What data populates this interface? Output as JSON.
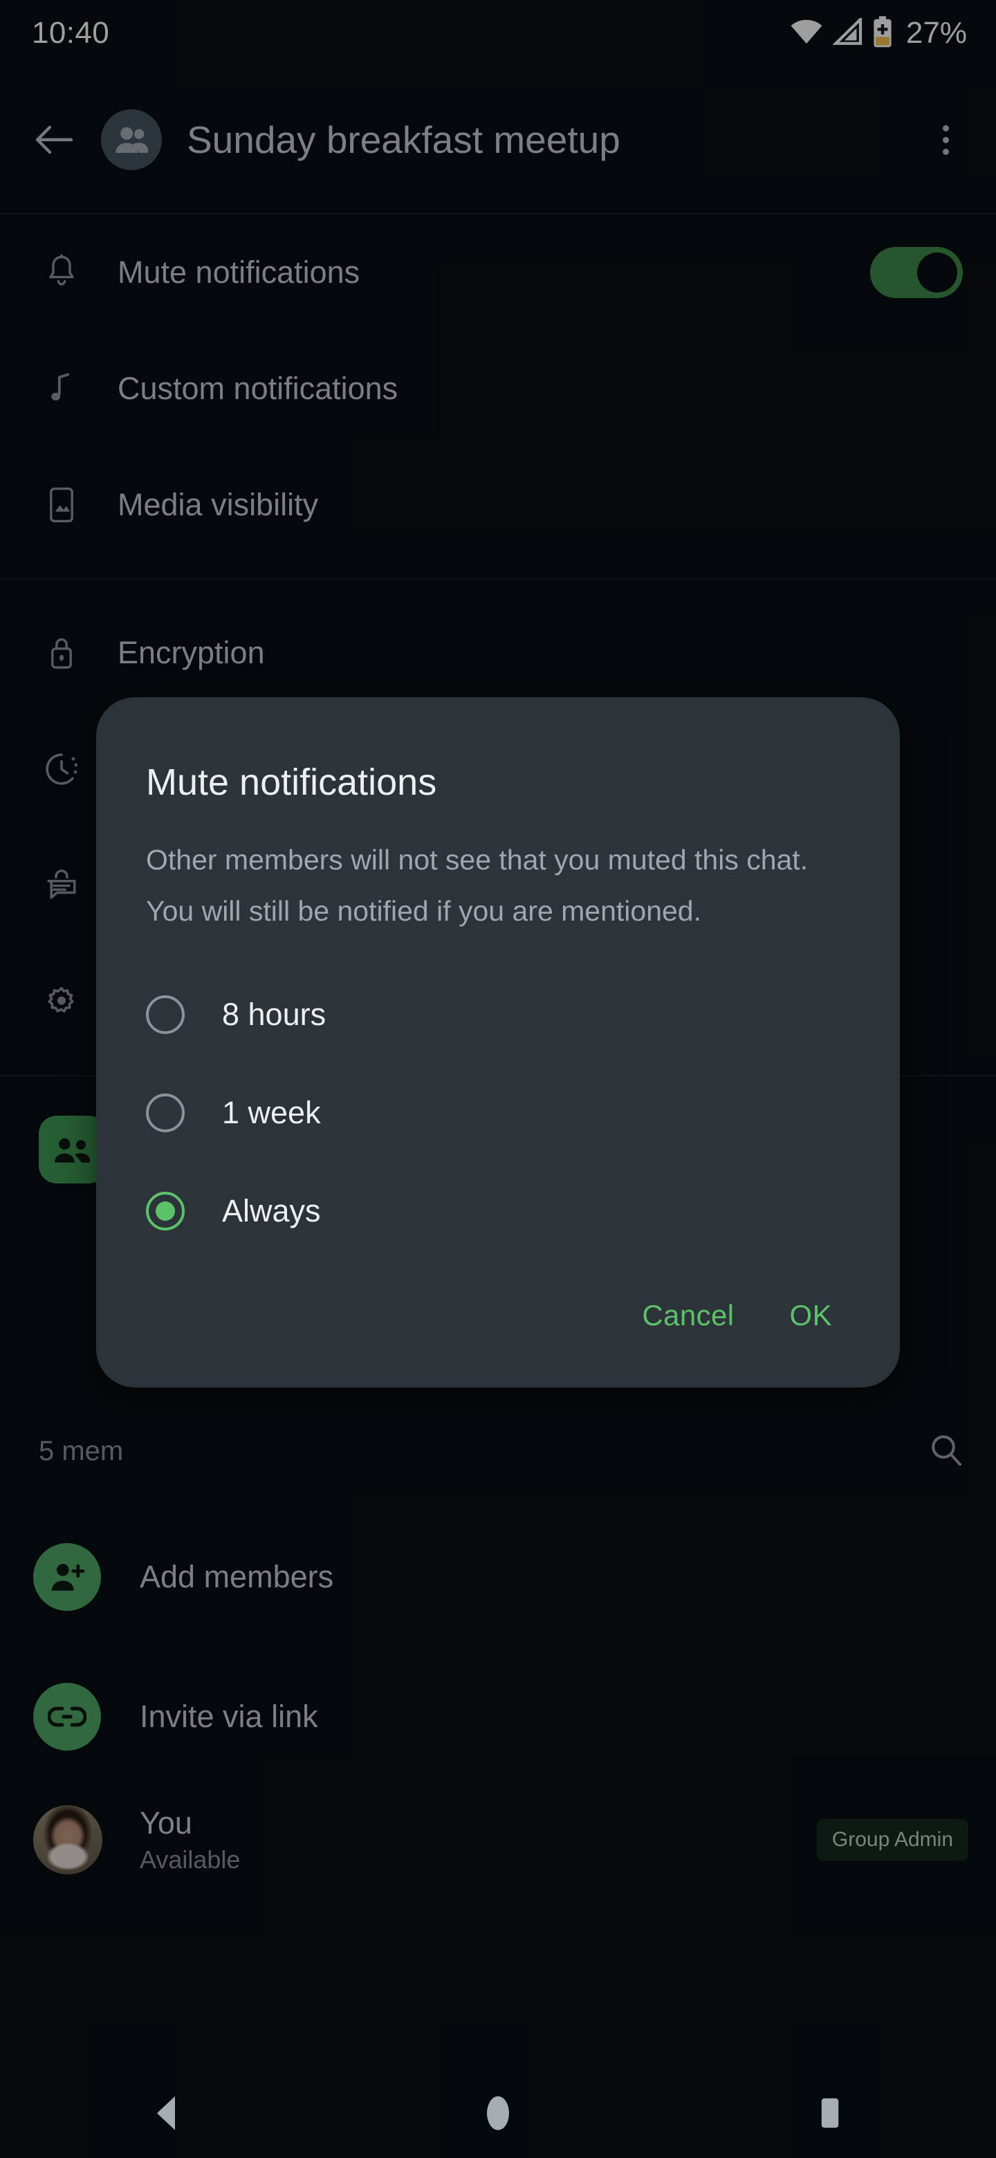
{
  "status_bar": {
    "time": "10:40",
    "battery_percent": "27%",
    "icons": [
      "wifi-icon",
      "cellular-signal-icon",
      "battery-saver-icon"
    ]
  },
  "app_bar": {
    "back_icon": "back-arrow-icon",
    "avatar_icon": "group-avatar-icon",
    "title": "Sunday breakfast meetup",
    "overflow_icon": "overflow-menu-icon"
  },
  "settings": {
    "items": [
      {
        "label": "Mute notifications",
        "icon": "bell-icon",
        "control": "toggle",
        "toggle_on": true
      },
      {
        "label": "Custom notifications",
        "icon": "music-note-icon",
        "control": "none"
      },
      {
        "label": "Media visibility",
        "icon": "media-image-icon",
        "control": "none"
      },
      {
        "label": "Encryption",
        "icon": "lock-icon",
        "control": "none"
      },
      {
        "label": "",
        "icon": "disappearing-timer-icon",
        "control": "none"
      },
      {
        "label": "",
        "icon": "locked-chat-icon",
        "control": "none"
      },
      {
        "label": "",
        "icon": "gear-icon",
        "control": "none"
      },
      {
        "label": "",
        "icon": "group-permissions-icon",
        "control": "none"
      }
    ]
  },
  "members_section": {
    "count_label": "5 mem",
    "search_icon": "search-icon",
    "actions": [
      {
        "label": "Add members",
        "icon": "add-person-icon"
      },
      {
        "label": "Invite via link",
        "icon": "link-icon"
      }
    ],
    "you": {
      "name": "You",
      "status": "Available",
      "badge": "Group Admin",
      "avatar": "user-photo-avatar"
    }
  },
  "dialog": {
    "title": "Mute notifications",
    "body": "Other members will not see that you muted this chat. You will still be notified if you are mentioned.",
    "options": [
      {
        "label": "8 hours",
        "selected": false
      },
      {
        "label": "1 week",
        "selected": false
      },
      {
        "label": "Always",
        "selected": true
      }
    ],
    "cancel_label": "Cancel",
    "ok_label": "OK"
  },
  "nav_bar": {
    "back_icon": "nav-back-icon",
    "home_icon": "nav-home-icon",
    "recents_icon": "nav-recents-icon"
  },
  "colors": {
    "background": "#0B0F12",
    "dialog_bg": "#2D3439",
    "accent_green": "#5CC26A",
    "toggle_green": "#3F8A49",
    "chip_green": "#4FA866",
    "badge_bg": "#16291D",
    "battery_amber": "#F4C24B"
  }
}
